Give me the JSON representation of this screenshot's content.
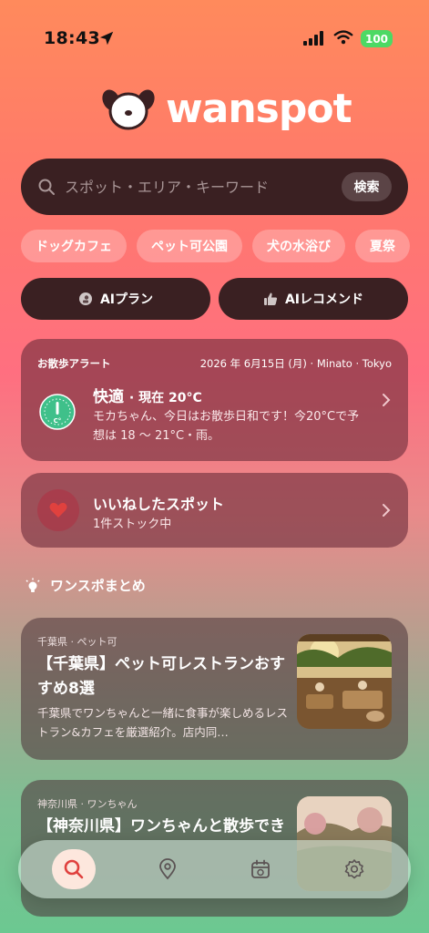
{
  "status_bar": {
    "time": "18:43",
    "battery": "100"
  },
  "app": {
    "name": "wanspot"
  },
  "search": {
    "placeholder": "スポット・エリア・キーワード",
    "button_label": "検索"
  },
  "chips": [
    "ドッグカフェ",
    "ペット可公園",
    "犬の水浴び",
    "夏祭"
  ],
  "ai_buttons": {
    "plan_label": "AIプラン",
    "recommend_label": "AIレコメンド"
  },
  "walk_alert": {
    "header": "お散歩アラート",
    "date_location": "2026 年 6月15日 (月) · Minato · Tokyo",
    "title": "快適",
    "temp_now": "· 現在 20°C",
    "message": "モカちゃん、今日はお散歩日和です！今20°Cで予想は 18 〜 21°C・雨。",
    "thermo_unit": "C°"
  },
  "liked": {
    "title": "いいねしたスポット",
    "subtitle": "1件ストック中"
  },
  "section": {
    "title": "ワンスポまとめ"
  },
  "articles": [
    {
      "meta": "千葉県 · ペット可",
      "title": "【千葉県】ペット可レストランおすすめ8選",
      "desc": "千葉県でワンちゃんと一緒に食事が楽しめるレストラン&カフェを厳選紹介。店内同…"
    },
    {
      "meta": "神奈川県 · ワンちゃん",
      "title": "【神奈川県】ワンちゃんと散歩でき",
      "desc": ""
    }
  ],
  "tabbar": {
    "items": [
      {
        "icon": "search-icon",
        "active": true
      },
      {
        "icon": "map-pin-icon",
        "active": false
      },
      {
        "icon": "calendar-icon",
        "active": false
      },
      {
        "icon": "gear-icon",
        "active": false
      }
    ]
  },
  "colors": {
    "dark_pill": "#3a2022",
    "accent_red": "#e0413e",
    "thermo_green": "#3fc08a",
    "battery_green": "#4cd964"
  }
}
